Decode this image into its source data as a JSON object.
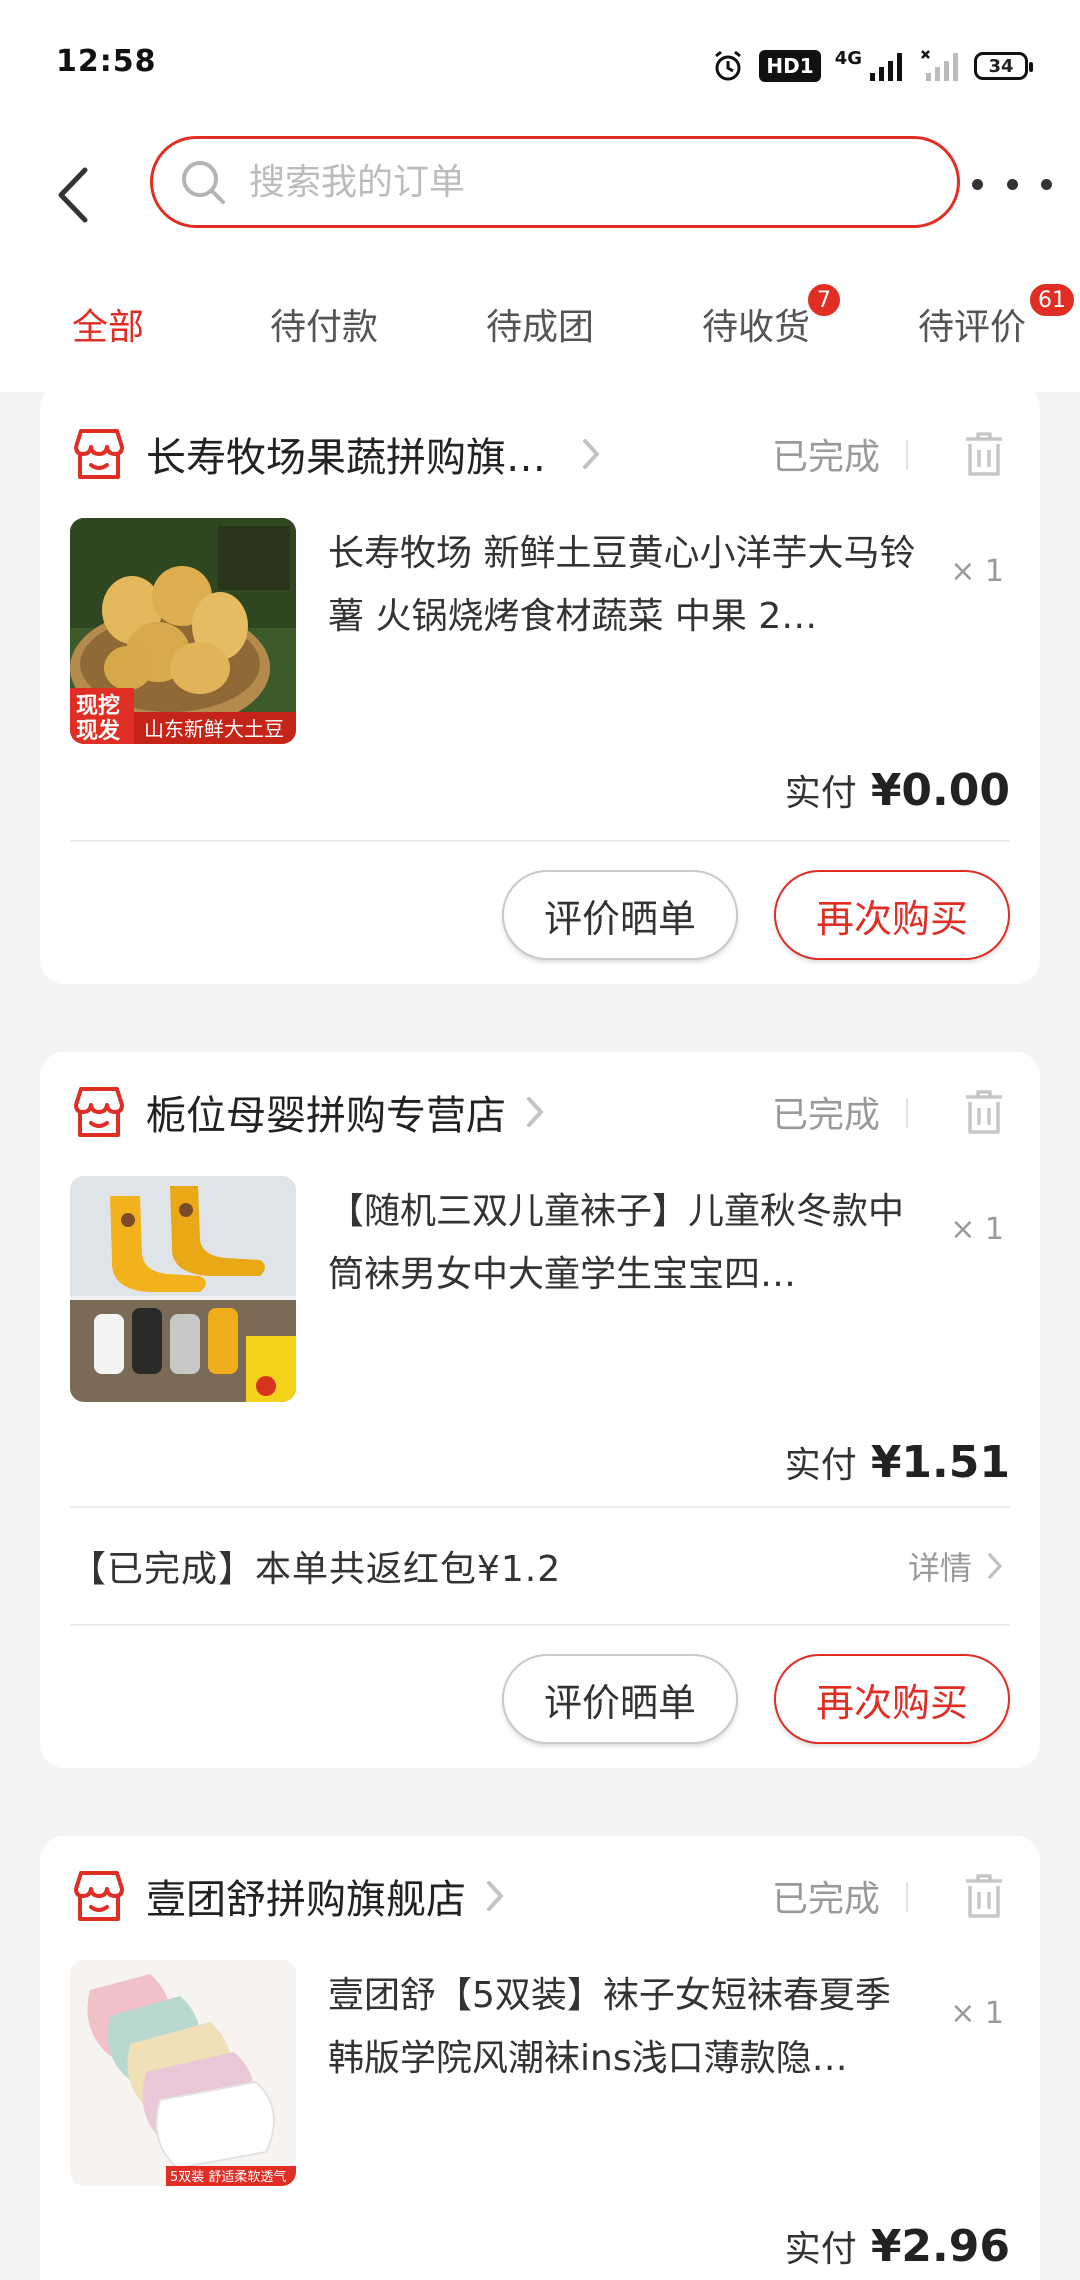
{
  "status_bar": {
    "time": "12:58",
    "hd_label": "HD1",
    "network_label": "4G",
    "battery": "34"
  },
  "header": {
    "search_placeholder": "搜索我的订单",
    "icons": [
      "back-arrow-icon",
      "search-icon",
      "more-icon"
    ]
  },
  "tabs": [
    {
      "label": "全部",
      "active": true,
      "badge": ""
    },
    {
      "label": "待付款",
      "active": false,
      "badge": ""
    },
    {
      "label": "待成团",
      "active": false,
      "badge": ""
    },
    {
      "label": "待收货",
      "active": false,
      "badge": "7"
    },
    {
      "label": "待评价",
      "active": false,
      "badge": "61"
    }
  ],
  "orders": [
    {
      "shop": "长寿牧场果蔬拼购旗…",
      "status": "已完成",
      "product_title": "长寿牧场 新鲜土豆黄心小洋芋大马铃薯 火锅烧烤食材蔬菜 中果 2…",
      "quantity": "× 1",
      "thumb_banner_left": "现挖现发",
      "thumb_banner_right": "山东新鲜大土豆",
      "paid_label": "实付",
      "paid_amount": "¥0.00",
      "buttons": {
        "review": "评价晒单",
        "rebuy": "再次购买"
      }
    },
    {
      "shop": "栀位母婴拼购专营店",
      "status": "已完成",
      "product_title": "【随机三双儿童袜子】儿童秋冬款中筒袜男女中大童学生宝宝四…",
      "quantity": "× 1",
      "paid_label": "实付",
      "paid_amount": "¥1.51",
      "refund_text": "【已完成】本单共返红包¥1.2",
      "refund_detail": "详情",
      "buttons": {
        "review": "评价晒单",
        "rebuy": "再次购买"
      }
    },
    {
      "shop": "壹团舒拼购旗舰店",
      "status": "已完成",
      "product_title": "壹团舒【5双装】袜子女短袜春夏季韩版学院风潮袜ins浅口薄款隐…",
      "quantity": "× 1",
      "thumb_banner": "5双装 舒适柔软透气",
      "paid_label": "实付",
      "paid_amount": "¥2.96"
    }
  ],
  "colors": {
    "accent": "#e02e24",
    "muted_text": "#9a9a9a",
    "background": "#f4f4f4"
  }
}
